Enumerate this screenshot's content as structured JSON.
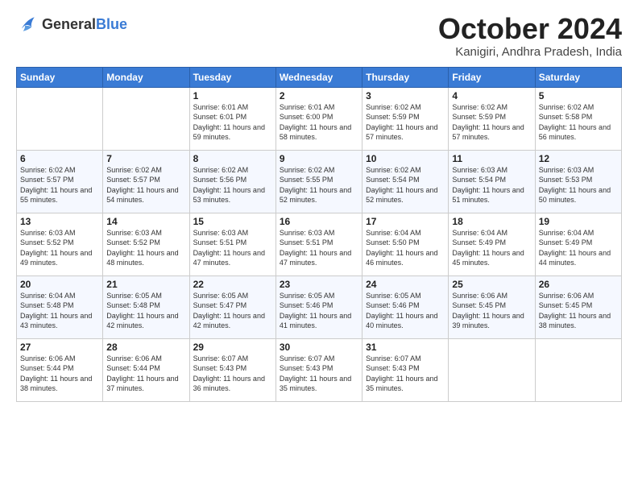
{
  "header": {
    "logo_general": "General",
    "logo_blue": "Blue",
    "month": "October 2024",
    "location": "Kanigiri, Andhra Pradesh, India"
  },
  "weekdays": [
    "Sunday",
    "Monday",
    "Tuesday",
    "Wednesday",
    "Thursday",
    "Friday",
    "Saturday"
  ],
  "weeks": [
    [
      {
        "day": "",
        "info": ""
      },
      {
        "day": "",
        "info": ""
      },
      {
        "day": "1",
        "info": "Sunrise: 6:01 AM\nSunset: 6:01 PM\nDaylight: 11 hours and 59 minutes."
      },
      {
        "day": "2",
        "info": "Sunrise: 6:01 AM\nSunset: 6:00 PM\nDaylight: 11 hours and 58 minutes."
      },
      {
        "day": "3",
        "info": "Sunrise: 6:02 AM\nSunset: 5:59 PM\nDaylight: 11 hours and 57 minutes."
      },
      {
        "day": "4",
        "info": "Sunrise: 6:02 AM\nSunset: 5:59 PM\nDaylight: 11 hours and 57 minutes."
      },
      {
        "day": "5",
        "info": "Sunrise: 6:02 AM\nSunset: 5:58 PM\nDaylight: 11 hours and 56 minutes."
      }
    ],
    [
      {
        "day": "6",
        "info": "Sunrise: 6:02 AM\nSunset: 5:57 PM\nDaylight: 11 hours and 55 minutes."
      },
      {
        "day": "7",
        "info": "Sunrise: 6:02 AM\nSunset: 5:57 PM\nDaylight: 11 hours and 54 minutes."
      },
      {
        "day": "8",
        "info": "Sunrise: 6:02 AM\nSunset: 5:56 PM\nDaylight: 11 hours and 53 minutes."
      },
      {
        "day": "9",
        "info": "Sunrise: 6:02 AM\nSunset: 5:55 PM\nDaylight: 11 hours and 52 minutes."
      },
      {
        "day": "10",
        "info": "Sunrise: 6:02 AM\nSunset: 5:54 PM\nDaylight: 11 hours and 52 minutes."
      },
      {
        "day": "11",
        "info": "Sunrise: 6:03 AM\nSunset: 5:54 PM\nDaylight: 11 hours and 51 minutes."
      },
      {
        "day": "12",
        "info": "Sunrise: 6:03 AM\nSunset: 5:53 PM\nDaylight: 11 hours and 50 minutes."
      }
    ],
    [
      {
        "day": "13",
        "info": "Sunrise: 6:03 AM\nSunset: 5:52 PM\nDaylight: 11 hours and 49 minutes."
      },
      {
        "day": "14",
        "info": "Sunrise: 6:03 AM\nSunset: 5:52 PM\nDaylight: 11 hours and 48 minutes."
      },
      {
        "day": "15",
        "info": "Sunrise: 6:03 AM\nSunset: 5:51 PM\nDaylight: 11 hours and 47 minutes."
      },
      {
        "day": "16",
        "info": "Sunrise: 6:03 AM\nSunset: 5:51 PM\nDaylight: 11 hours and 47 minutes."
      },
      {
        "day": "17",
        "info": "Sunrise: 6:04 AM\nSunset: 5:50 PM\nDaylight: 11 hours and 46 minutes."
      },
      {
        "day": "18",
        "info": "Sunrise: 6:04 AM\nSunset: 5:49 PM\nDaylight: 11 hours and 45 minutes."
      },
      {
        "day": "19",
        "info": "Sunrise: 6:04 AM\nSunset: 5:49 PM\nDaylight: 11 hours and 44 minutes."
      }
    ],
    [
      {
        "day": "20",
        "info": "Sunrise: 6:04 AM\nSunset: 5:48 PM\nDaylight: 11 hours and 43 minutes."
      },
      {
        "day": "21",
        "info": "Sunrise: 6:05 AM\nSunset: 5:48 PM\nDaylight: 11 hours and 42 minutes."
      },
      {
        "day": "22",
        "info": "Sunrise: 6:05 AM\nSunset: 5:47 PM\nDaylight: 11 hours and 42 minutes."
      },
      {
        "day": "23",
        "info": "Sunrise: 6:05 AM\nSunset: 5:46 PM\nDaylight: 11 hours and 41 minutes."
      },
      {
        "day": "24",
        "info": "Sunrise: 6:05 AM\nSunset: 5:46 PM\nDaylight: 11 hours and 40 minutes."
      },
      {
        "day": "25",
        "info": "Sunrise: 6:06 AM\nSunset: 5:45 PM\nDaylight: 11 hours and 39 minutes."
      },
      {
        "day": "26",
        "info": "Sunrise: 6:06 AM\nSunset: 5:45 PM\nDaylight: 11 hours and 38 minutes."
      }
    ],
    [
      {
        "day": "27",
        "info": "Sunrise: 6:06 AM\nSunset: 5:44 PM\nDaylight: 11 hours and 38 minutes."
      },
      {
        "day": "28",
        "info": "Sunrise: 6:06 AM\nSunset: 5:44 PM\nDaylight: 11 hours and 37 minutes."
      },
      {
        "day": "29",
        "info": "Sunrise: 6:07 AM\nSunset: 5:43 PM\nDaylight: 11 hours and 36 minutes."
      },
      {
        "day": "30",
        "info": "Sunrise: 6:07 AM\nSunset: 5:43 PM\nDaylight: 11 hours and 35 minutes."
      },
      {
        "day": "31",
        "info": "Sunrise: 6:07 AM\nSunset: 5:43 PM\nDaylight: 11 hours and 35 minutes."
      },
      {
        "day": "",
        "info": ""
      },
      {
        "day": "",
        "info": ""
      }
    ]
  ]
}
